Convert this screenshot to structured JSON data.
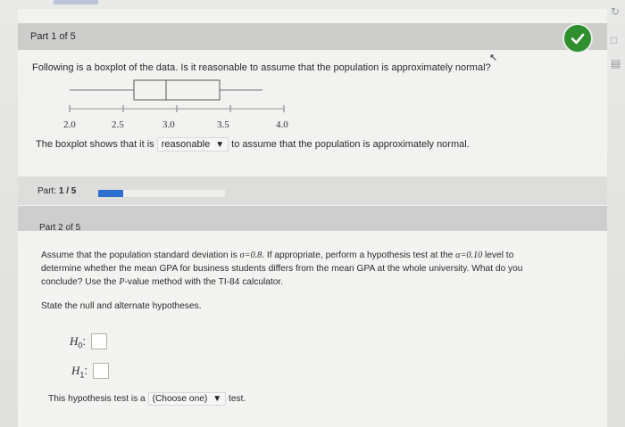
{
  "part1": {
    "header": "Part 1 of 5",
    "question": "Following is a boxplot of the data. Is it reasonable to assume that the population is approximately normal?",
    "boxplot": {
      "ticks": [
        "2.0",
        "2.5",
        "3.0",
        "3.5",
        "4.0"
      ],
      "min": 2.0,
      "q1": 2.6,
      "median": 2.9,
      "q3": 3.4,
      "max": 3.8
    },
    "answer_prefix": "The boxplot shows that it is",
    "answer_value": "reasonable",
    "answer_suffix": "to assume that the population is approximately normal."
  },
  "progress": {
    "label": "Part: ",
    "value": "1 / 5",
    "fraction": 0.2
  },
  "part2": {
    "header": "Part 2 of 5",
    "q_line1_a": "Assume that the population standard deviation is ",
    "q_sigma": "σ=0.8",
    "q_line1_b": ". If appropriate, perform a hypothesis test at the ",
    "q_alpha": "α=0.10",
    "q_line1_c": " level to",
    "q_line2": "determine whether the mean GPA for business students differs from the mean GPA at the whole university. What do you",
    "q_line3_a": "conclude? Use the ",
    "q_pvalue": "P",
    "q_line3_b": "-value method with the TI-84 calculator.",
    "instruction": "State the null and alternate hypotheses.",
    "h0": "H",
    "h0_sub": "0",
    "h1": "H",
    "h1_sub": "1",
    "test_prefix": "This hypothesis test is a",
    "test_select": "(Choose one)",
    "test_suffix": "test."
  },
  "colors": {
    "check_green": "#2f8f2f",
    "progress_blue": "#2f6fd0"
  }
}
